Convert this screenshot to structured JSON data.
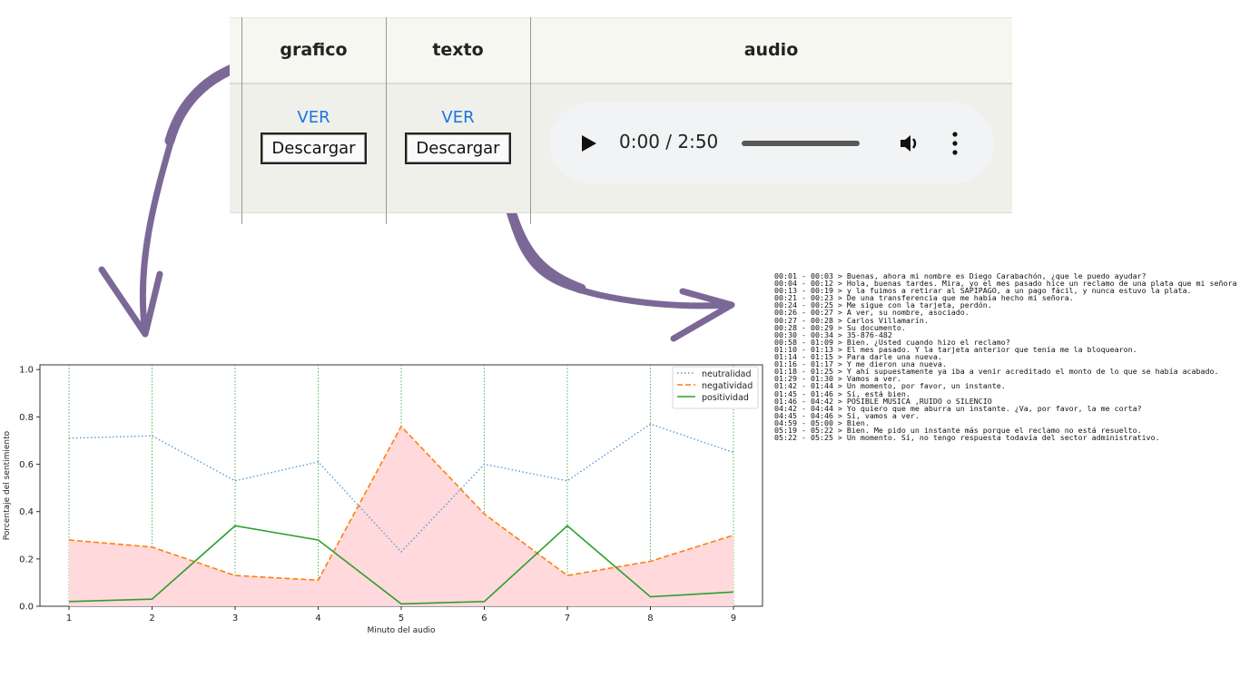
{
  "table": {
    "headers": [
      "grafico",
      "texto",
      "audio"
    ],
    "grafico": {
      "link": "VER",
      "button": "Descargar"
    },
    "texto": {
      "link": "VER",
      "button": "Descargar"
    },
    "audio": {
      "time": "0:00 / 2:50",
      "progress": 0,
      "icons": [
        "play-icon",
        "volume-icon",
        "more-options-icon"
      ]
    }
  },
  "colors": {
    "arrow": "#7c6896",
    "link": "#1a73e8",
    "neutralidad": "#5b9bd5",
    "negatividad": "#ff7f0e",
    "positividad": "#2ca02c",
    "fill": "#ffd9dc"
  },
  "chart_data": {
    "type": "line",
    "x": [
      1,
      2,
      3,
      4,
      5,
      6,
      7,
      8,
      9
    ],
    "xlabel": "Minuto del audio",
    "ylabel": "Porcentaje del sentimiento",
    "ylim": [
      0.0,
      1.0
    ],
    "yticks": [
      "0.0",
      "0.2",
      "0.4",
      "0.6",
      "0.8",
      "1.0"
    ],
    "xticks": [
      "1",
      "2",
      "3",
      "4",
      "5",
      "6",
      "7",
      "8",
      "9"
    ],
    "legend_position": "top-right",
    "series": [
      {
        "name": "neutralidad",
        "style": "dotted",
        "values": [
          0.71,
          0.72,
          0.53,
          0.61,
          0.23,
          0.6,
          0.53,
          0.77,
          0.65
        ]
      },
      {
        "name": "negatividad",
        "style": "dashed",
        "values": [
          0.28,
          0.25,
          0.13,
          0.11,
          0.76,
          0.39,
          0.13,
          0.19,
          0.3
        ]
      },
      {
        "name": "positividad",
        "style": "solid",
        "values": [
          0.02,
          0.03,
          0.34,
          0.28,
          0.01,
          0.02,
          0.34,
          0.04,
          0.06
        ]
      }
    ],
    "area_fill": "negatividad",
    "vertical_gridlines": "green dotted"
  },
  "transcript": [
    "00:01 - 00:03 > Buenas, ahora mi nombre es Diego Carabachón, ¿que le puedo ayudar?",
    "00:04 - 00:12 > Hola, buenas tardes. Mira, yo el mes pasado hice un reclamo de una plata que mi señora",
    "00:13 - 00:19 > y la fuimos a retirar al SAPIPAGO, a un pago fácil, y nunca estuvo la plata.",
    "00:21 - 00:23 > De una transferencia que me había hecho mi señora.",
    "00:24 - 00:25 > Me sigue con la tarjeta, perdón.",
    "00:26 - 00:27 > A ver, su nombre, asociado.",
    "00:27 - 00:28 > Carlos Villamarín.",
    "00:28 - 00:29 > Su documento.",
    "00:30 - 00:34 > 35-876-482",
    "00:58 - 01:09 > Bien. ¿Usted cuando hizo el reclamo?",
    "01:10 - 01:13 > El mes pasado. Y la tarjeta anterior que tenía me la bloquearon.",
    "01:14 - 01:15 > Para darle una nueva.",
    "01:16 - 01:17 > Y me dieron una nueva.",
    "01:18 - 01:25 > Y ahí supuestamente ya iba a venir acreditado el monto de lo que se había acabado.",
    "01:29 - 01:30 > Vamos a ver.",
    "01:42 - 01:44 > Un momento, por favor, un instante.",
    "01:45 - 01:46 > Sí, está bien.",
    "01:46 - 04:42 > POSIBLE MUSICA ,RUIDO o SILENCIO",
    "04:42 - 04:44 > Yo quiero que me aburra un instante. ¿Va, por favor, la me corta?",
    "04:45 - 04:46 > Sí, vamos a ver.",
    "04:59 - 05:00 > Bien.",
    "05:19 - 05:22 > Bien. Me pido un instante más porque el reclamo no está resuelto.",
    "05:22 - 05:25 > Un momento. Sí, no tengo respuesta todavía del sector administrativo."
  ]
}
